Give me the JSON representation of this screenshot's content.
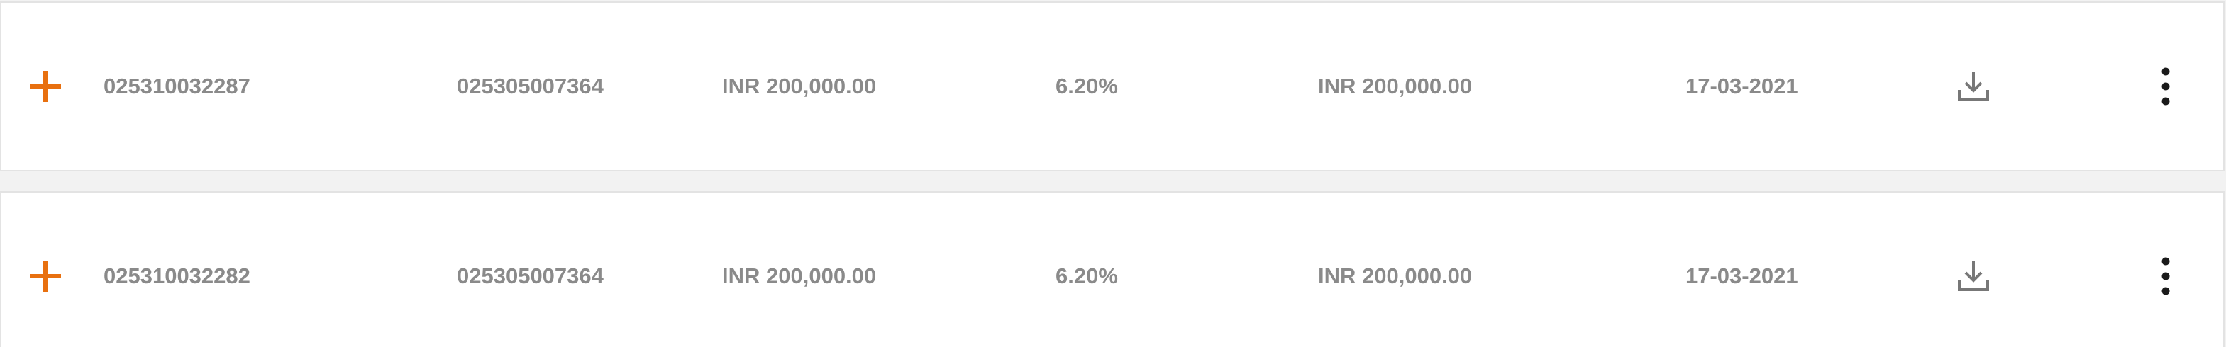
{
  "theme": {
    "accent": "#e8700f",
    "text": "#8a8a8a",
    "icon": "#777777",
    "more": "#1a1a1a"
  },
  "rows": [
    {
      "expand_icon": "plus-icon",
      "account_no": "025310032287",
      "reference_no": "025305007364",
      "amount": "INR 200,000.00",
      "rate": "6.20%",
      "maturity_amount": "INR 200,000.00",
      "date": "17-03-2021",
      "download_icon": "download-icon",
      "more_icon": "more-vertical-icon"
    },
    {
      "expand_icon": "plus-icon",
      "account_no": "025310032282",
      "reference_no": "025305007364",
      "amount": "INR 200,000.00",
      "rate": "6.20%",
      "maturity_amount": "INR 200,000.00",
      "date": "17-03-2021",
      "download_icon": "download-icon",
      "more_icon": "more-vertical-icon"
    }
  ]
}
